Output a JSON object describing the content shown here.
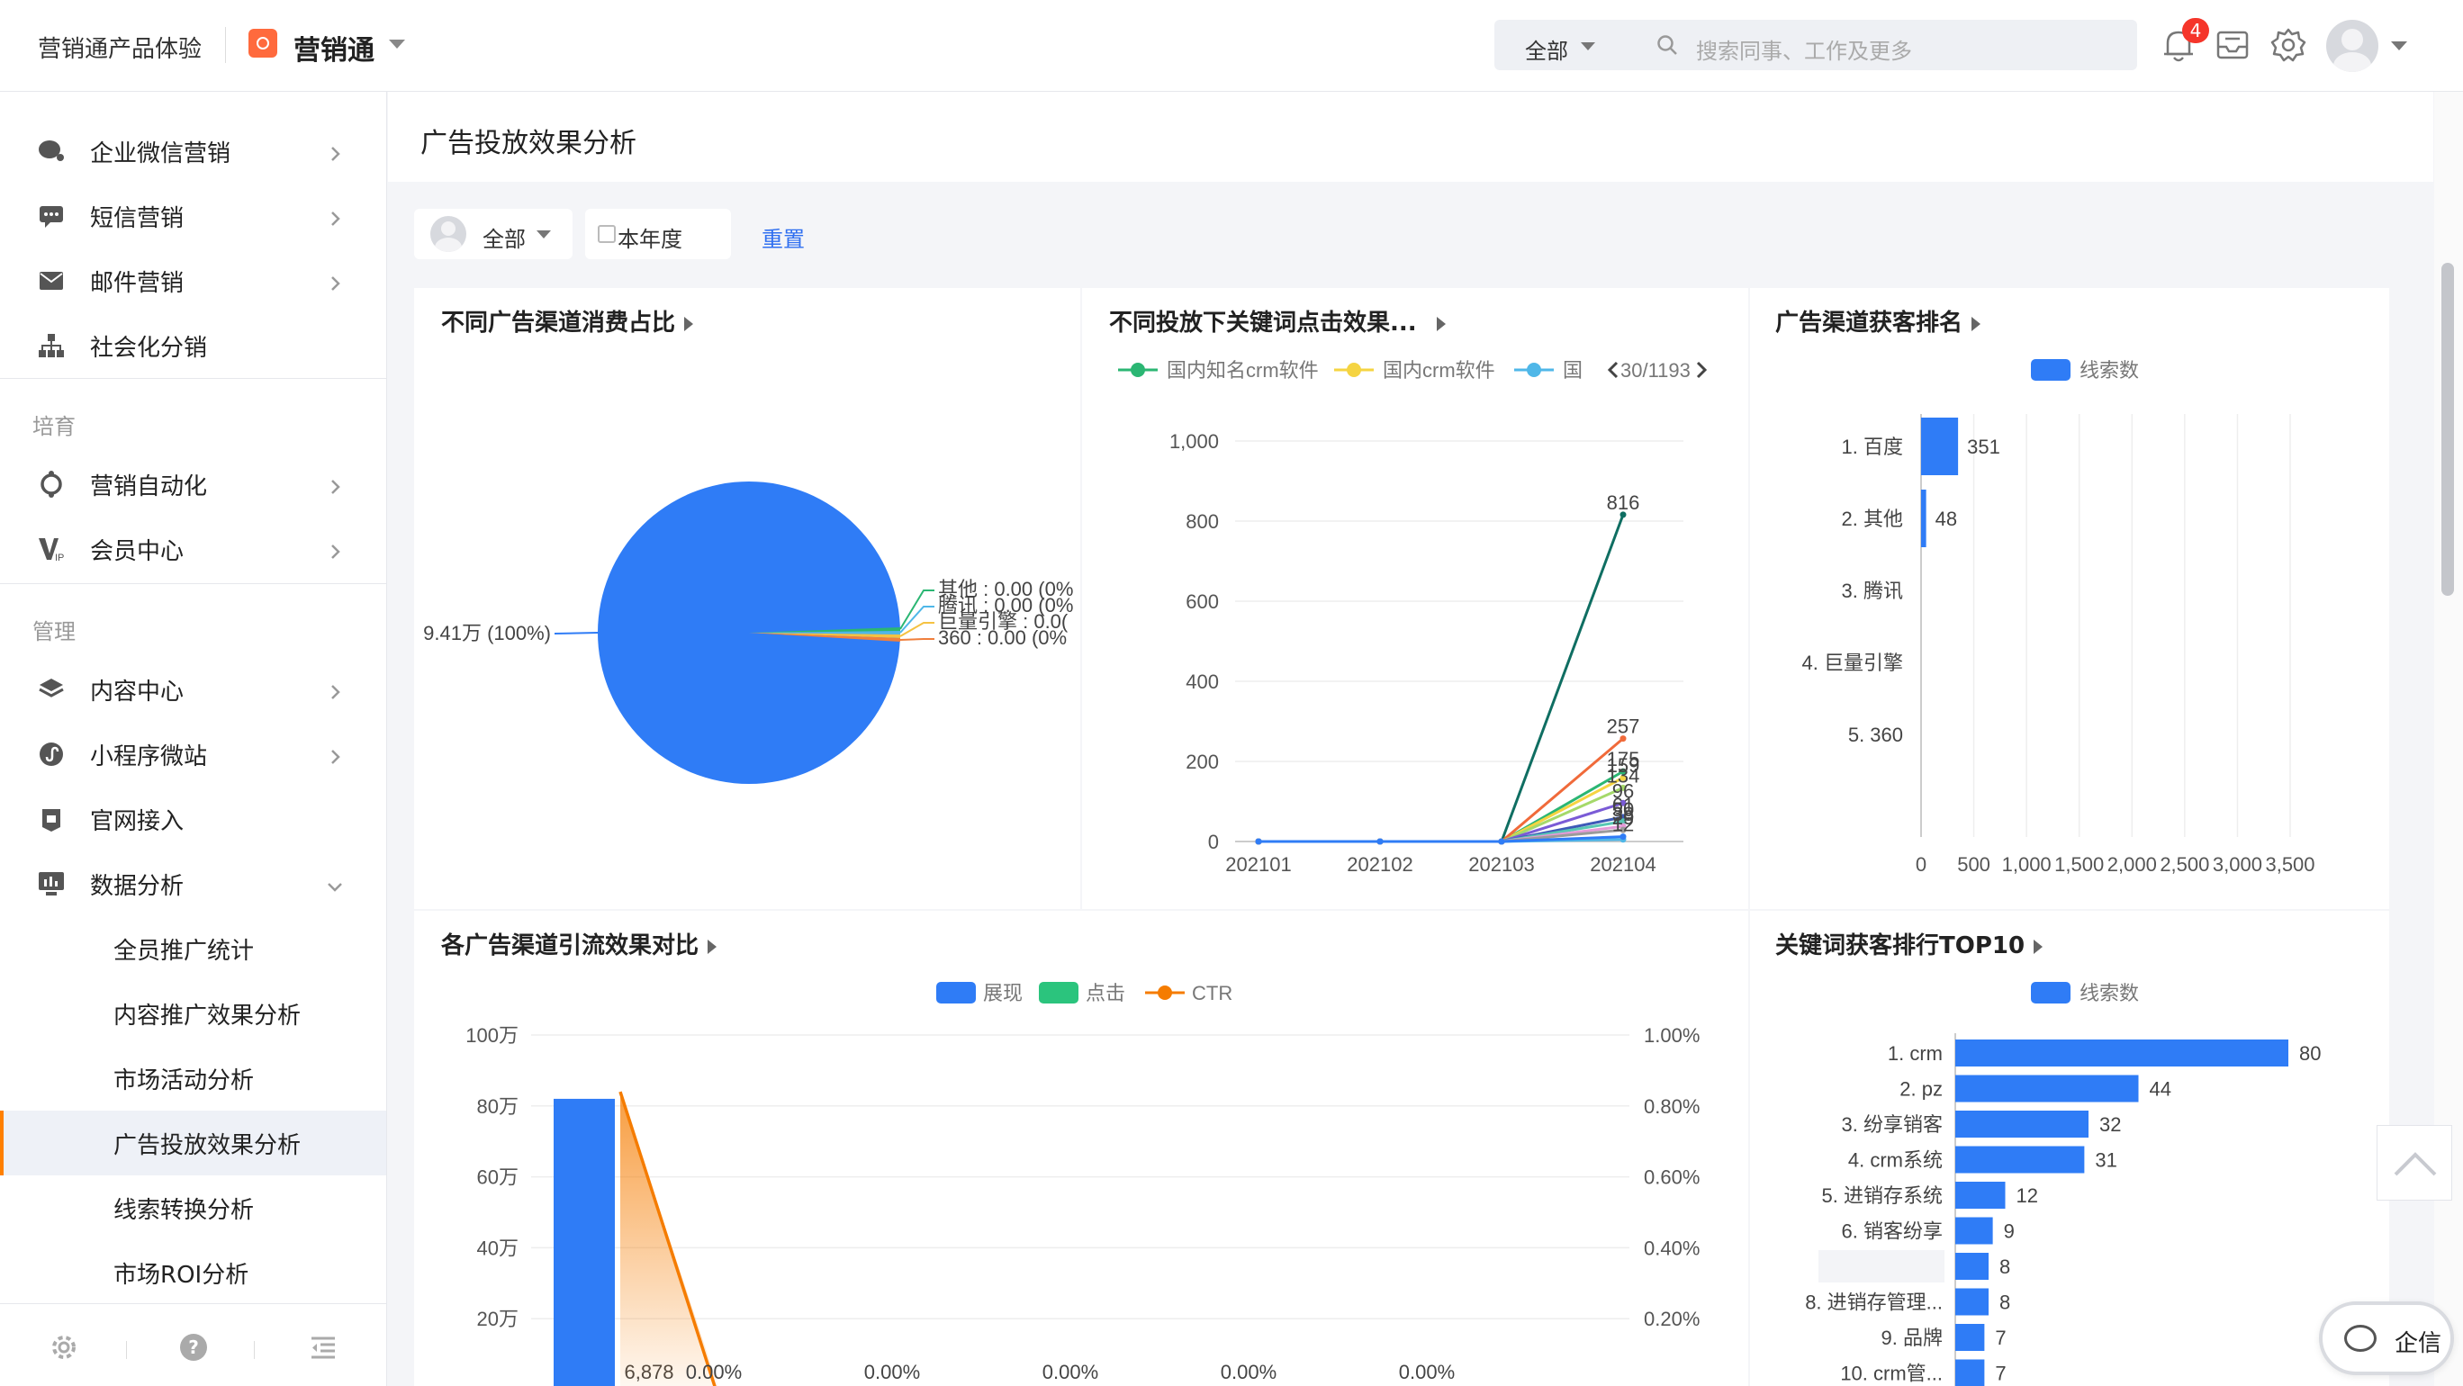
{
  "topbar": {
    "workspace": "营销通产品体验",
    "app_name": "营销通",
    "search_scope": "全部",
    "search_placeholder": "搜索同事、工作及更多",
    "notification_count": "4"
  },
  "sidebar": {
    "items_top": [
      {
        "label": "企业微信营销",
        "icon": "wechat-icon"
      },
      {
        "label": "短信营销",
        "icon": "sms-icon"
      },
      {
        "label": "邮件营销",
        "icon": "mail-icon"
      },
      {
        "label": "社会化分销",
        "icon": "hierarchy-icon"
      }
    ],
    "group_nurture": "培育",
    "items_nurture": [
      {
        "label": "营销自动化",
        "icon": "automation-icon"
      },
      {
        "label": "会员中心",
        "icon": "vip-icon"
      }
    ],
    "group_manage": "管理",
    "items_manage": [
      {
        "label": "内容中心",
        "icon": "layers-icon"
      },
      {
        "label": "小程序微站",
        "icon": "miniprogram-icon"
      },
      {
        "label": "官网接入",
        "icon": "website-icon"
      },
      {
        "label": "数据分析",
        "icon": "data-analysis-icon"
      }
    ],
    "sub_items": [
      "全员推广统计",
      "内容推广效果分析",
      "市场活动分析",
      "广告投放效果分析",
      "线索转换分析",
      "市场ROI分析"
    ],
    "active_sub": "广告投放效果分析",
    "accent": "#ff8000"
  },
  "page": {
    "title": "广告投放效果分析",
    "filter_owner": "全部",
    "filter_date": "本年度",
    "reset": "重置"
  },
  "charts": {
    "pie": {
      "title": "不同广告渠道消费占比",
      "main_label": "9.41万 (100%)",
      "slice_labels": [
        "其他 : 0.00 (0%",
        "腾讯 : 0.00 (0%",
        "巨量引擎 : 0.0(",
        "360 : 0.00 (0%"
      ]
    },
    "keyword_line": {
      "title": "不同投放下关键词点击效果...",
      "legend": [
        "国内知名crm软件",
        "国内crm软件",
        "国"
      ],
      "pager": "30/1193"
    },
    "channel_rank": {
      "title": "广告渠道获客排名",
      "legend": "线索数"
    },
    "traffic": {
      "title": "各广告渠道引流效果对比",
      "legend": [
        "展现",
        "点击",
        "CTR"
      ]
    },
    "keyword_top": {
      "title": "关键词获客排行TOP10",
      "legend": "线索数"
    }
  },
  "chart_data": [
    {
      "type": "pie",
      "title": "不同广告渠道消费占比",
      "slices": [
        {
          "name": "百度",
          "value": 94100,
          "label": "9.41万 (100%)"
        },
        {
          "name": "其他",
          "value": 0
        },
        {
          "name": "腾讯",
          "value": 0
        },
        {
          "name": "巨量引擎",
          "value": 0
        },
        {
          "name": "360",
          "value": 0
        }
      ],
      "colors": [
        "#2f7cf6",
        "#2bb673",
        "#4fb7e8",
        "#f5c242",
        "#f07f3c"
      ]
    },
    {
      "type": "line",
      "title": "不同投放下关键词点击效果...",
      "x": [
        "202101",
        "202102",
        "202103",
        "202104"
      ],
      "ylim": [
        0,
        1000
      ],
      "yticks": [
        "0",
        "200",
        "400",
        "600",
        "800",
        "1,000"
      ],
      "series": [
        {
          "name": "国内知名crm软件",
          "color": "#2bb673",
          "values": [
            0,
            0,
            0,
            175
          ]
        },
        {
          "name": "国内crm软件",
          "color": "#f5d442",
          "values": [
            0,
            0,
            0,
            159
          ]
        },
        {
          "name": "国",
          "color": "#4fb7e8",
          "values": [
            0,
            0,
            0,
            5
          ]
        },
        {
          "color": "#0f6e62",
          "values": [
            0,
            0,
            0,
            816
          ]
        },
        {
          "color": "#f06a3a",
          "values": [
            0,
            0,
            0,
            257
          ]
        },
        {
          "color": "#a5d96a",
          "values": [
            0,
            0,
            0,
            134
          ]
        },
        {
          "color": "#7a5bd6",
          "values": [
            0,
            0,
            0,
            96
          ]
        },
        {
          "color": "#3d5ab8",
          "values": [
            0,
            0,
            0,
            61
          ]
        },
        {
          "color": "#58c7b4",
          "values": [
            0,
            0,
            0,
            50
          ]
        },
        {
          "color": "#e59bd8",
          "values": [
            0,
            0,
            0,
            38
          ]
        },
        {
          "color": "#9b9b9b",
          "values": [
            0,
            0,
            0,
            29
          ]
        },
        {
          "color": "#2f7cf6",
          "values": [
            0,
            0,
            0,
            12
          ]
        }
      ],
      "value_labels": [
        {
          "series": 3,
          "text": "816"
        },
        {
          "series": 4,
          "text": "257"
        },
        {
          "series": 0,
          "text": "175"
        },
        {
          "series": 1,
          "text": "159"
        },
        {
          "series": 5,
          "text": "134"
        },
        {
          "series": 6,
          "text": "96"
        },
        {
          "series": 7,
          "text": "61"
        },
        {
          "series": 8,
          "text": "50"
        },
        {
          "series": 9,
          "text": "38"
        },
        {
          "series": 10,
          "text": "29"
        },
        {
          "series": 11,
          "text": "12"
        }
      ]
    },
    {
      "type": "bar",
      "orientation": "horizontal",
      "title": "广告渠道获客排名",
      "categories": [
        "1. 百度",
        "2. 其他",
        "3. 腾讯",
        "4. 巨量引擎",
        "5. 360"
      ],
      "series": [
        {
          "name": "线索数",
          "values": [
            351,
            48,
            0,
            0,
            0
          ]
        }
      ],
      "xlim": [
        0,
        3500
      ],
      "xticks": [
        "0",
        "500",
        "1,000",
        "1,500",
        "2,000",
        "2,500",
        "3,000",
        "3,500"
      ],
      "color": "#2f7cf6"
    },
    {
      "type": "bar",
      "title": "各广告渠道引流效果对比",
      "series": [
        {
          "name": "展现",
          "values": [
            820000
          ],
          "color": "#2f7cf6"
        },
        {
          "name": "点击",
          "values": [
            6878
          ],
          "color": "#2bc47d"
        },
        {
          "name": "CTR",
          "values": [
            0.0084,
            0,
            0,
            0,
            0,
            0
          ],
          "color": "#f57c00"
        }
      ],
      "bar_data_label": "6,878",
      "ctr_labels": [
        "0.00%",
        "0.00%",
        "0.00%",
        "0.00%",
        "0.00%"
      ],
      "ylim_left": [
        0,
        1000000
      ],
      "yticks_left": [
        "20万",
        "40万",
        "60万",
        "80万",
        "100万"
      ],
      "ylim_right": [
        0,
        0.01
      ],
      "yticks_right": [
        "0.20%",
        "0.40%",
        "0.60%",
        "0.80%",
        "1.00%"
      ]
    },
    {
      "type": "bar",
      "orientation": "horizontal",
      "title": "关键词获客排行TOP10",
      "categories": [
        "1. crm",
        "2. pz",
        "3. 纷享销客",
        "4. crm系统",
        "5. 进销存系统",
        "6. 销客纷享",
        "",
        "8. 进销存管理...",
        "9. 品牌",
        "10. crm管..."
      ],
      "series": [
        {
          "name": "线索数",
          "values": [
            80,
            44,
            32,
            31,
            12,
            9,
            8,
            8,
            7,
            7
          ]
        }
      ],
      "xlim": [
        0,
        100
      ],
      "color": "#2f7cf6"
    }
  ]
}
